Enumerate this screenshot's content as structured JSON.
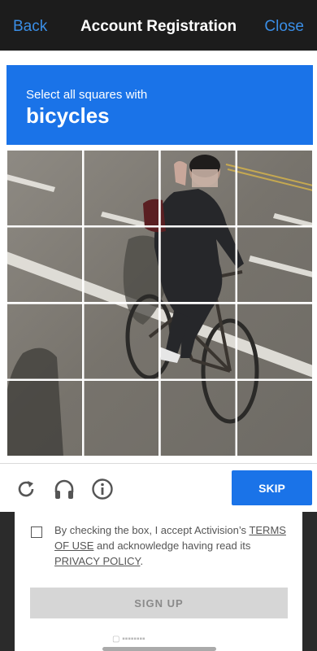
{
  "nav": {
    "back_label": "Back",
    "title": "Account Registration",
    "close_label": "Close"
  },
  "captcha": {
    "instruction": "Select all squares with",
    "target": "bicycles",
    "grid": {
      "rows": 4,
      "cols": 4
    },
    "skip_label": "SKIP",
    "icons": [
      "reload-icon",
      "headphones-icon",
      "info-icon"
    ]
  },
  "form": {
    "consent_prefix": "By checking the box, I accept Activision’s ",
    "terms_link": "TERMS OF USE",
    "consent_middle": " and acknowledge having read its ",
    "privacy_link": "PRIVACY POLICY",
    "consent_suffix": ".",
    "signup_label": "SIGN UP",
    "checked": false
  },
  "colors": {
    "accent": "#1a73e8",
    "nav_link": "#3a8ee6",
    "nav_bg": "#1c1c1c"
  }
}
